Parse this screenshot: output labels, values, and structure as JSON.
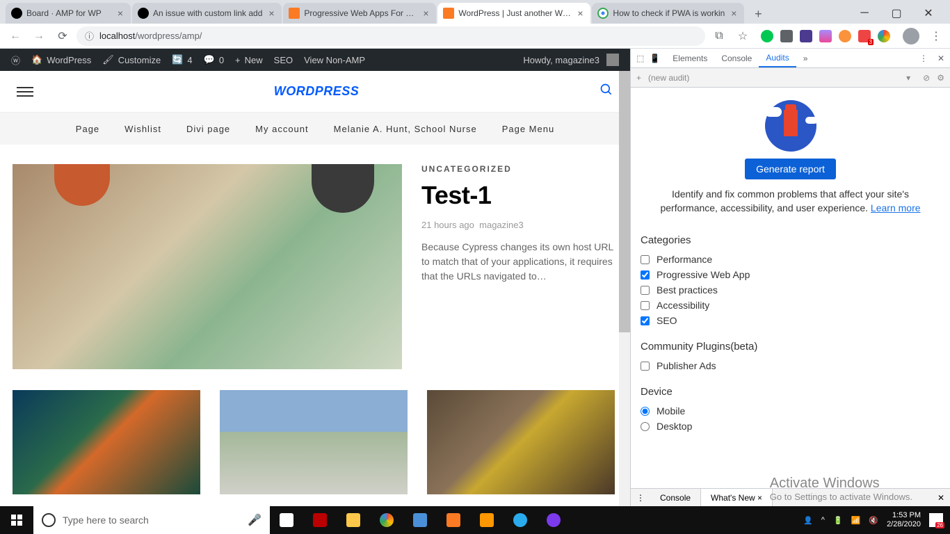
{
  "browser": {
    "tabs": [
      {
        "title": "Board · AMP for WP",
        "favicon": "gh"
      },
      {
        "title": "An issue with custom link add",
        "favicon": "gh"
      },
      {
        "title": "Progressive Web Apps For WP",
        "favicon": "xampp"
      },
      {
        "title": "WordPress | Just another Word",
        "favicon": "xampp",
        "active": true
      },
      {
        "title": "How to check if PWA is workin",
        "favicon": "chrome"
      }
    ],
    "url_host": "localhost",
    "url_path": "/wordpress/amp/"
  },
  "wpbar": {
    "site": "WordPress",
    "customize": "Customize",
    "updates": "4",
    "comments": "0",
    "new": "New",
    "seo": "SEO",
    "viewnonamp": "View Non-AMP",
    "greeting": "Howdy, magazine3"
  },
  "header": {
    "title": "WORDPRESS"
  },
  "nav": [
    "Page",
    "Wishlist",
    "Divi page",
    "My account",
    "Melanie A. Hunt, School Nurse",
    "Page Menu"
  ],
  "post": {
    "category": "UNCATEGORIZED",
    "title": "Test-1",
    "time": "21 hours ago",
    "author": "magazine3",
    "excerpt": "Because Cypress changes its own host URL to match that of your applications, it requires that the URLs navigated to…"
  },
  "devtools": {
    "tabs": [
      "Elements",
      "Console",
      "Audits"
    ],
    "active_tab": "Audits",
    "new_audit": "(new audit)",
    "generate": "Generate report",
    "desc": "Identify and fix common problems that affect your site's performance, accessibility, and user experience.",
    "learn_more": "Learn more",
    "categories_title": "Categories",
    "categories": [
      {
        "label": "Performance",
        "checked": false
      },
      {
        "label": "Progressive Web App",
        "checked": true
      },
      {
        "label": "Best practices",
        "checked": false
      },
      {
        "label": "Accessibility",
        "checked": false
      },
      {
        "label": "SEO",
        "checked": true
      }
    ],
    "plugins_title": "Community Plugins(beta)",
    "plugins": [
      {
        "label": "Publisher Ads",
        "checked": false
      }
    ],
    "device_title": "Device",
    "devices": [
      {
        "label": "Mobile",
        "checked": true
      },
      {
        "label": "Desktop",
        "checked": false
      }
    ],
    "footer": {
      "console": "Console",
      "whatsnew": "What's New"
    }
  },
  "watermark": {
    "title": "Activate Windows",
    "sub": "Go to Settings to activate Windows."
  },
  "taskbar": {
    "search_placeholder": "Type here to search",
    "time": "1:53 PM",
    "date": "2/28/2020",
    "notif_count": "26"
  }
}
